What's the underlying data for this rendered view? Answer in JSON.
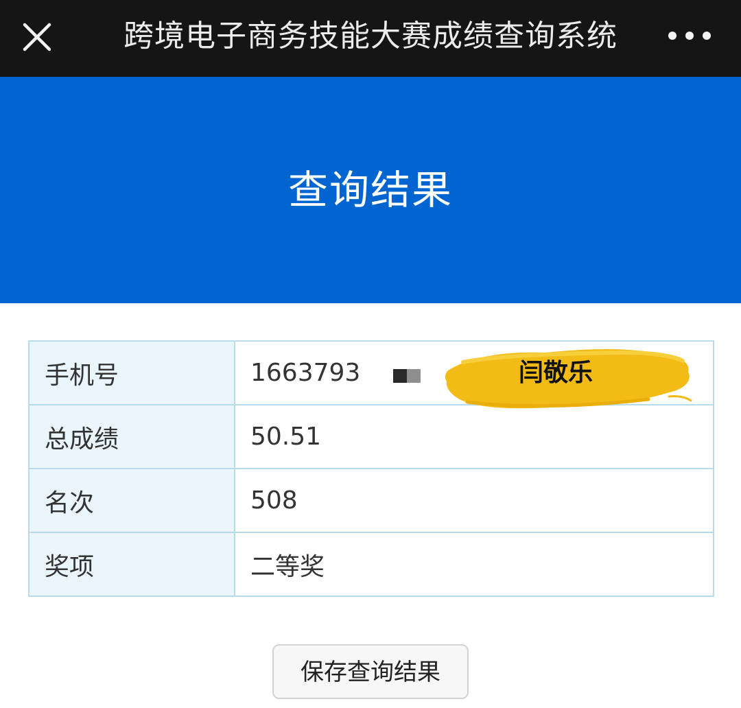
{
  "topbar": {
    "title": "跨境电子商务技能大赛成绩查询系统",
    "close_icon": "close-icon",
    "more_icon": "more-horizontal-icon"
  },
  "banner": {
    "title": "查询结果",
    "color": "#0065d1"
  },
  "result_table": {
    "rows": [
      {
        "label": "手机号",
        "value": "1663793"
      },
      {
        "label": "总成绩",
        "value": "50.51"
      },
      {
        "label": "名次",
        "value": "508"
      },
      {
        "label": "奖项",
        "value": "二等奖"
      }
    ]
  },
  "overlay": {
    "text": "闫敬乐",
    "color": "#f2bb16"
  },
  "save_button": {
    "label": "保存查询结果"
  }
}
